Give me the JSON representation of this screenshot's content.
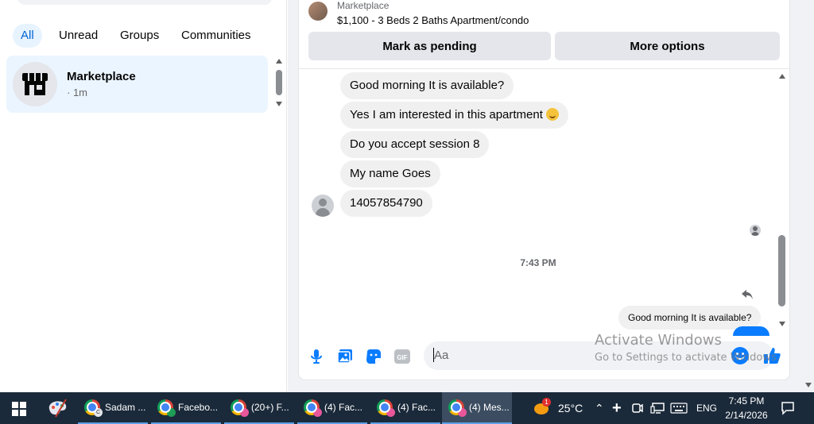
{
  "filters": [
    "All",
    "Unread",
    "Groups",
    "Communities"
  ],
  "conversation": {
    "name": "Marketplace",
    "time": "· 1m"
  },
  "listing": {
    "source": "Marketplace",
    "title": "$1,100 - 3 Beds 2 Baths Apartment/condo",
    "pending_label": "Mark as pending",
    "more_label": "More options"
  },
  "messages": [
    "Good morning It is available?",
    "Yes I am interested in this apartment",
    "Do you accept session 8",
    "My name Goes",
    "14057854790"
  ],
  "timestamp": "7:43 PM",
  "reply_text": "Good morning It is available?",
  "composer": {
    "placeholder": "Aa"
  },
  "watermark": {
    "line1": "Activate Windows",
    "line2": "Go to Settings to activate Windows."
  },
  "taskbar": {
    "apps": [
      {
        "label": "Sadam ...",
        "badge": "C"
      },
      {
        "label": "Facebo...",
        "badge": ""
      },
      {
        "label": "(20+) F...",
        "badge": ""
      },
      {
        "label": "(4) Fac...",
        "badge": ""
      },
      {
        "label": "(4) Fac...",
        "badge": ""
      },
      {
        "label": "(4) Mes...",
        "badge": ""
      }
    ],
    "weather_badge": "1",
    "temperature": "25°C",
    "language": "ENG",
    "clock_time": "7:45 PM",
    "clock_date": "2/14/2026"
  },
  "colors": {
    "accent": "#0064d1",
    "messenger_blue": "#0a7cff",
    "taskbar": "#1b2a3a"
  }
}
